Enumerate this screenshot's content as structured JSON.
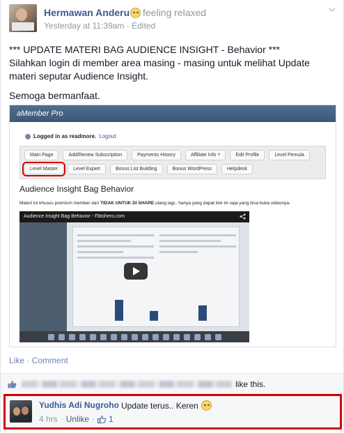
{
  "post": {
    "author": "Hermawan Anderu",
    "feeling": "feeling relaxed",
    "time": "Yesterday at 11:39am",
    "edited": "Edited",
    "separator": " · ",
    "line1": "*** UPDATE MATERI BAG AUDIENCE INSIGHT - Behavior ***",
    "line2": "Silahkan login di member area masing - masing untuk melihat Update materi seputar Audience Insight.",
    "line3": "Semoga bermanfaat."
  },
  "embedded": {
    "app_title": "aMember Pro",
    "logged_in": "Logged in as readmore.",
    "logout": "Logout",
    "nav_row1": [
      "Main Page",
      "Add/Renew Subscription",
      "Payments History",
      "Affiliate Info ˅",
      "Edit Profile",
      "Level Pemula"
    ],
    "nav_row2": [
      "Level Master",
      "Level Expert",
      "Bonus List Building",
      "Bonus WordPress",
      "Helpdesk"
    ],
    "highlighted_nav": "Level Master",
    "heading": "Audience Insight Bag Behavior",
    "desc_pre": "Materi ini khusus premium member dan ",
    "desc_bold": "TIDAK UNTUK DI SHARE",
    "desc_post": " ulang lagi.. hanya yang dapat link ini saja yang bisa buka videonya.",
    "video_title": "Audience Insight Bag Behavior - Fbtohero.com"
  },
  "actions": {
    "like": "Like",
    "comment": "Comment",
    "dot": " · "
  },
  "likes": {
    "suffix": "like this."
  },
  "comment": {
    "author": "Yudhis Adi Nugroho",
    "text": "Update terus.. Keren",
    "time": "4 hrs",
    "unlike": "Unlike",
    "like_count": "1",
    "dot": " · "
  },
  "colors": {
    "link": "#3b5998",
    "highlight_border": "#d40000",
    "meta": "#9197a3"
  }
}
